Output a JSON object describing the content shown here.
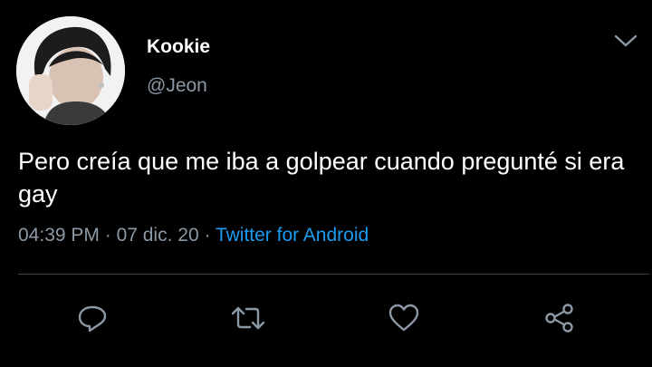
{
  "tweet": {
    "display_name": "Kookie",
    "handle": "@Jeon",
    "text": "Pero creía que me iba a golpear cuando pregunté si era gay",
    "time": "04:39 PM",
    "separator_1": " · ",
    "date": "07 dic. 20",
    "separator_2": " · ",
    "source": "Twitter for Android"
  },
  "icons": {
    "menu": "chevron-down-icon",
    "reply": "reply-icon",
    "retweet": "retweet-icon",
    "like": "heart-icon",
    "share": "share-icon"
  },
  "colors": {
    "background": "#000000",
    "primary_text": "#ffffff",
    "secondary_text": "#8b98a5",
    "link": "#1d9bf0",
    "divider": "#3d4146"
  }
}
